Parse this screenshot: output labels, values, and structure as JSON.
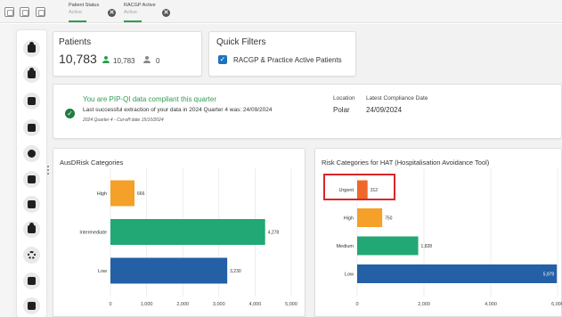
{
  "filter_bar": {
    "chips": [
      {
        "name": "Patient Status",
        "value": "Active"
      },
      {
        "name": "RACGP Active",
        "value": "Active"
      }
    ],
    "close_glyph": "✕"
  },
  "sidebar": {
    "items": [
      "patient-search-icon",
      "person-icon",
      "calculator-icon",
      "calendar-icon",
      "account-circle-icon",
      "report-icon",
      "clipboard-icon",
      "accessibility-icon",
      "settings-icon",
      "search-doc-icon",
      "medical-bag-icon"
    ]
  },
  "patients": {
    "title": "Patients",
    "total": "10,783",
    "active_count": "10,783",
    "inactive_count": "0",
    "active_color": "#2e9e4f",
    "inactive_color": "#888888"
  },
  "quick_filters": {
    "title": "Quick Filters",
    "items": [
      {
        "label": "RACGP & Practice Active Patients",
        "checked": true
      }
    ],
    "check_glyph": "✓"
  },
  "compliance": {
    "title": "You are PIP-QI data compliant this quarter",
    "line": "Last successful extraction of your data in 2024 Quarter 4 was: 24/09/2024",
    "sub": "2024 Quarter 4 - Cut-off date 15/10/2024",
    "location_label": "Location",
    "location_value": "Polar",
    "date_label": "Latest Compliance Date",
    "date_value": "24/09/2024",
    "check_glyph": "✓"
  },
  "chart_data": [
    {
      "type": "bar",
      "orientation": "horizontal",
      "title": "AusDRisk Categories",
      "categories": [
        "High",
        "Intermediate",
        "Low"
      ],
      "values": [
        666,
        4278,
        3230
      ],
      "value_labels": [
        "666",
        "4,278",
        "3,230"
      ],
      "colors": [
        "#f5a028",
        "#21a874",
        "#2360a5"
      ],
      "xlim": [
        0,
        5000
      ],
      "ticks": [
        0,
        1000,
        2000,
        3000,
        4000,
        5000
      ],
      "tick_labels": [
        "0",
        "1,000",
        "2,000",
        "3,000",
        "4,000",
        "5,000"
      ],
      "grid": true,
      "label_position": [
        "outside",
        "outside",
        "outside"
      ]
    },
    {
      "type": "bar",
      "orientation": "horizontal",
      "title": "Risk Categories for HAT (Hospitalisation Avoidance Tool)",
      "categories": [
        "Urgent",
        "High",
        "Medium",
        "Low"
      ],
      "values": [
        312,
        750,
        1828,
        5979
      ],
      "value_labels": [
        "312",
        "750",
        "1,828",
        "5,979"
      ],
      "colors": [
        "#f0672a",
        "#f5a028",
        "#21a874",
        "#2360a5"
      ],
      "xlim": [
        0,
        6000
      ],
      "ticks": [
        0,
        2000,
        4000,
        6000
      ],
      "tick_labels": [
        "0",
        "2,000",
        "4,000",
        "6,000"
      ],
      "grid": true,
      "label_position": [
        "outside",
        "outside",
        "outside",
        "inside"
      ],
      "highlighted_category": "Urgent",
      "highlight_color": "#d9262b"
    }
  ]
}
